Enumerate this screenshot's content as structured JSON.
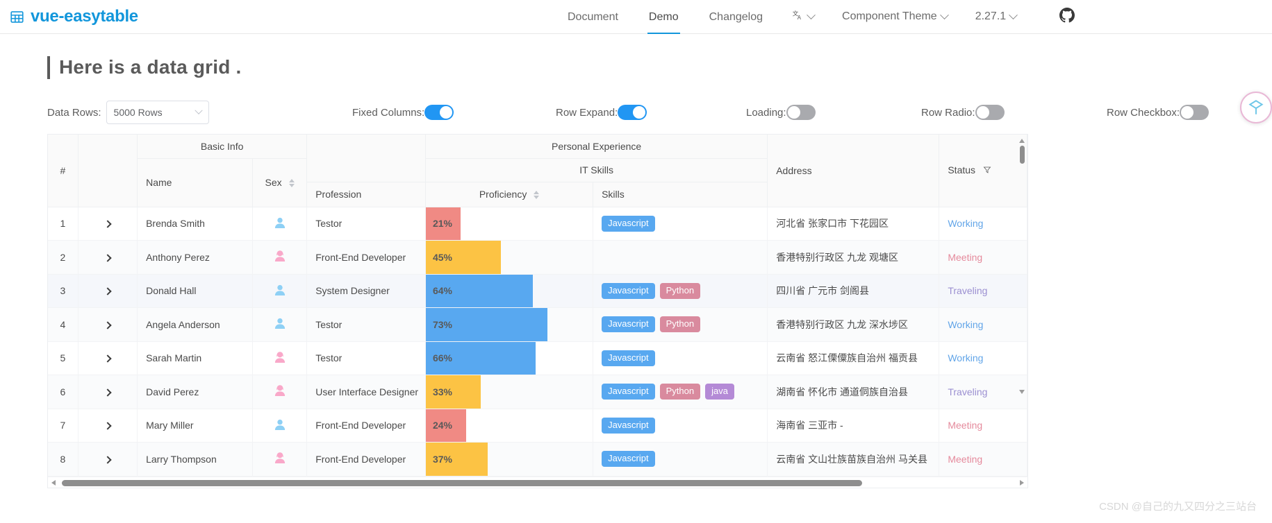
{
  "navbar": {
    "brand": "vue-easytable",
    "brand_icon": "table-grid-icon",
    "links": [
      {
        "label": "Document",
        "active": false
      },
      {
        "label": "Demo",
        "active": true
      },
      {
        "label": "Changelog",
        "active": false
      }
    ],
    "language_icon": "translate-icon",
    "theme_dropdown": "Component Theme",
    "version_dropdown": "2.27.1",
    "github_icon": "github-icon"
  },
  "page": {
    "title": "Here is a data grid ."
  },
  "controls": {
    "data_rows_label": "Data Rows:",
    "data_rows_value": "5000 Rows",
    "toggles": [
      {
        "label": "Fixed Columns:",
        "state": "on"
      },
      {
        "label": "Row Expand:",
        "state": "on"
      },
      {
        "label": "Loading:",
        "state": "off"
      },
      {
        "label": "Row Radio:",
        "state": "off"
      },
      {
        "label": "Row Checkbox:",
        "state": "off"
      }
    ]
  },
  "table": {
    "group_headers": {
      "basic_info": "Basic Info",
      "personal_experience": "Personal Experience",
      "it_skills": "IT Skills"
    },
    "columns": {
      "index": "#",
      "name": "Name",
      "sex": "Sex",
      "profession": "Profession",
      "proficiency": "Proficiency",
      "skills": "Skills",
      "address": "Address",
      "status": "Status"
    },
    "rows": [
      {
        "index": "1",
        "name": "Brenda Smith",
        "sex": "male",
        "profession": "Testor",
        "proficiency": "21%",
        "proficiency_value": 21,
        "proficiency_color": "#f08a84",
        "skills": [
          {
            "label": "Javascript",
            "color": "#58a8f0"
          }
        ],
        "address": "河北省 张家口市 下花园区",
        "status": "Working",
        "status_color": "#62a5e8"
      },
      {
        "index": "2",
        "name": "Anthony Perez",
        "sex": "female",
        "profession": "Front-End Developer",
        "proficiency": "45%",
        "proficiency_value": 45,
        "proficiency_color": "#fcc344",
        "skills": [],
        "address": "香港特别行政区 九龙 观塘区",
        "status": "Meeting",
        "status_color": "#e58a9c"
      },
      {
        "index": "3",
        "name": "Donald Hall",
        "sex": "male",
        "profession": "System Designer",
        "proficiency": "64%",
        "proficiency_value": 64,
        "proficiency_color": "#58a8f0",
        "skills": [
          {
            "label": "Javascript",
            "color": "#58a8f0"
          },
          {
            "label": "Python",
            "color": "#d98a9e"
          }
        ],
        "address": "四川省 广元市 剑阁县",
        "status": "Traveling",
        "status_color": "#9b8fd1"
      },
      {
        "index": "4",
        "name": "Angela Anderson",
        "sex": "male",
        "profession": "Testor",
        "proficiency": "73%",
        "proficiency_value": 73,
        "proficiency_color": "#58a8f0",
        "skills": [
          {
            "label": "Javascript",
            "color": "#58a8f0"
          },
          {
            "label": "Python",
            "color": "#d98a9e"
          }
        ],
        "address": "香港特别行政区 九龙 深水埗区",
        "status": "Working",
        "status_color": "#62a5e8"
      },
      {
        "index": "5",
        "name": "Sarah Martin",
        "sex": "female",
        "profession": "Testor",
        "proficiency": "66%",
        "proficiency_value": 66,
        "proficiency_color": "#58a8f0",
        "skills": [
          {
            "label": "Javascript",
            "color": "#58a8f0"
          }
        ],
        "address": "云南省 怒江傈僳族自治州 福贡县",
        "status": "Working",
        "status_color": "#62a5e8"
      },
      {
        "index": "6",
        "name": "David Perez",
        "sex": "female",
        "profession": "User Interface Designer",
        "proficiency": "33%",
        "proficiency_value": 33,
        "proficiency_color": "#fcc344",
        "skills": [
          {
            "label": "Javascript",
            "color": "#58a8f0"
          },
          {
            "label": "Python",
            "color": "#d98a9e"
          },
          {
            "label": "java",
            "color": "#b48ad6"
          }
        ],
        "address": "湖南省 怀化市 通道侗族自治县",
        "status": "Traveling",
        "status_color": "#9b8fd1"
      },
      {
        "index": "7",
        "name": "Mary Miller",
        "sex": "male",
        "profession": "Front-End Developer",
        "proficiency": "24%",
        "proficiency_value": 24,
        "proficiency_color": "#f08a84",
        "skills": [
          {
            "label": "Javascript",
            "color": "#58a8f0"
          }
        ],
        "address": "海南省 三亚市 -",
        "status": "Meeting",
        "status_color": "#e58a9c"
      },
      {
        "index": "8",
        "name": "Larry Thompson",
        "sex": "female",
        "profession": "Front-End Developer",
        "proficiency": "37%",
        "proficiency_value": 37,
        "proficiency_color": "#fcc344",
        "skills": [
          {
            "label": "Javascript",
            "color": "#58a8f0"
          }
        ],
        "address": "云南省 文山壮族苗族自治州 马关县",
        "status": "Meeting",
        "status_color": "#e58a9c"
      }
    ]
  },
  "watermark": "CSDN @自己的九又四分之三站台",
  "colors": {
    "brand": "#1296db",
    "accent": "#2196f3",
    "male_icon": "#8ed0f5",
    "female_icon": "#f9a8c9"
  }
}
